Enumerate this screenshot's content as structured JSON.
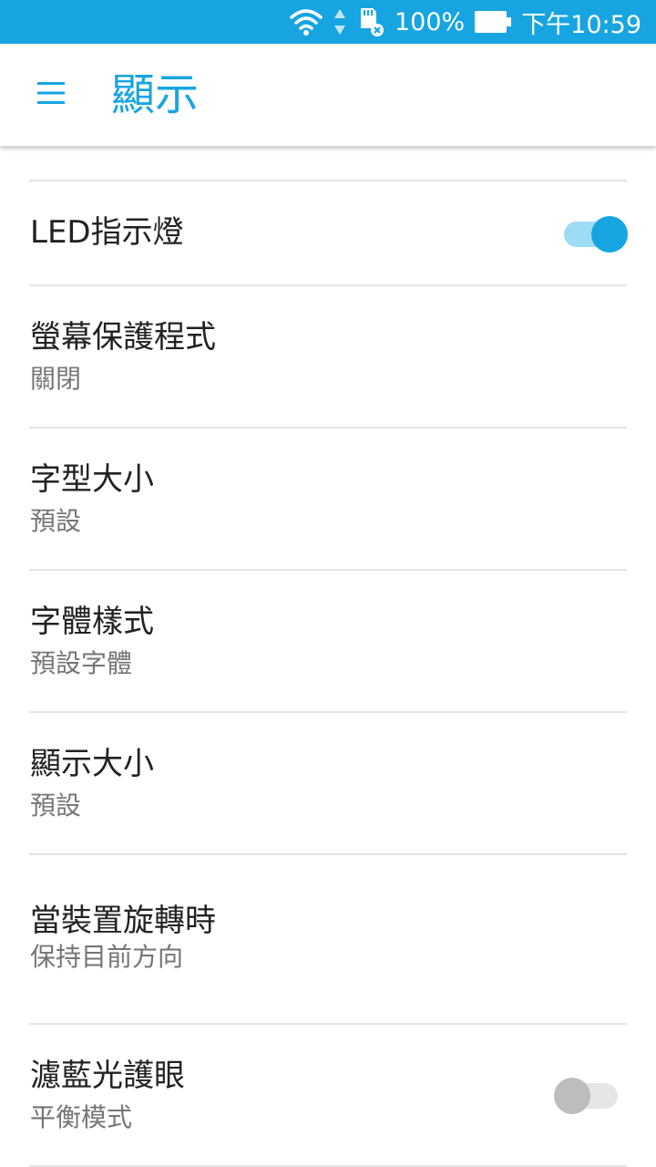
{
  "status_bar": {
    "battery_percent": "100%",
    "time": "下午10:59",
    "icons": [
      "wifi-icon",
      "data-activity-icon",
      "sd-card-icon",
      "battery-icon"
    ],
    "color": "#17a5e1"
  },
  "app_bar": {
    "menu_icon": "hamburger-menu-icon",
    "title": "顯示"
  },
  "settings": {
    "led": {
      "title": "LED指示燈",
      "enabled": true
    },
    "screensaver": {
      "title": "螢幕保護程式",
      "value": "關閉"
    },
    "font_size": {
      "title": "字型大小",
      "value": "預設"
    },
    "font_style": {
      "title": "字體樣式",
      "value": "預設字體"
    },
    "display_size": {
      "title": "顯示大小",
      "value": "預設"
    },
    "rotation": {
      "title": "當裝置旋轉時",
      "value": "保持目前方向"
    },
    "blue_light": {
      "title": "濾藍光護眼",
      "value": "平衡模式",
      "enabled": false
    }
  },
  "colors": {
    "accent": "#17a5e1",
    "switch_on_track": "#9edbf4",
    "switch_off_thumb": "#bdbdbd"
  }
}
